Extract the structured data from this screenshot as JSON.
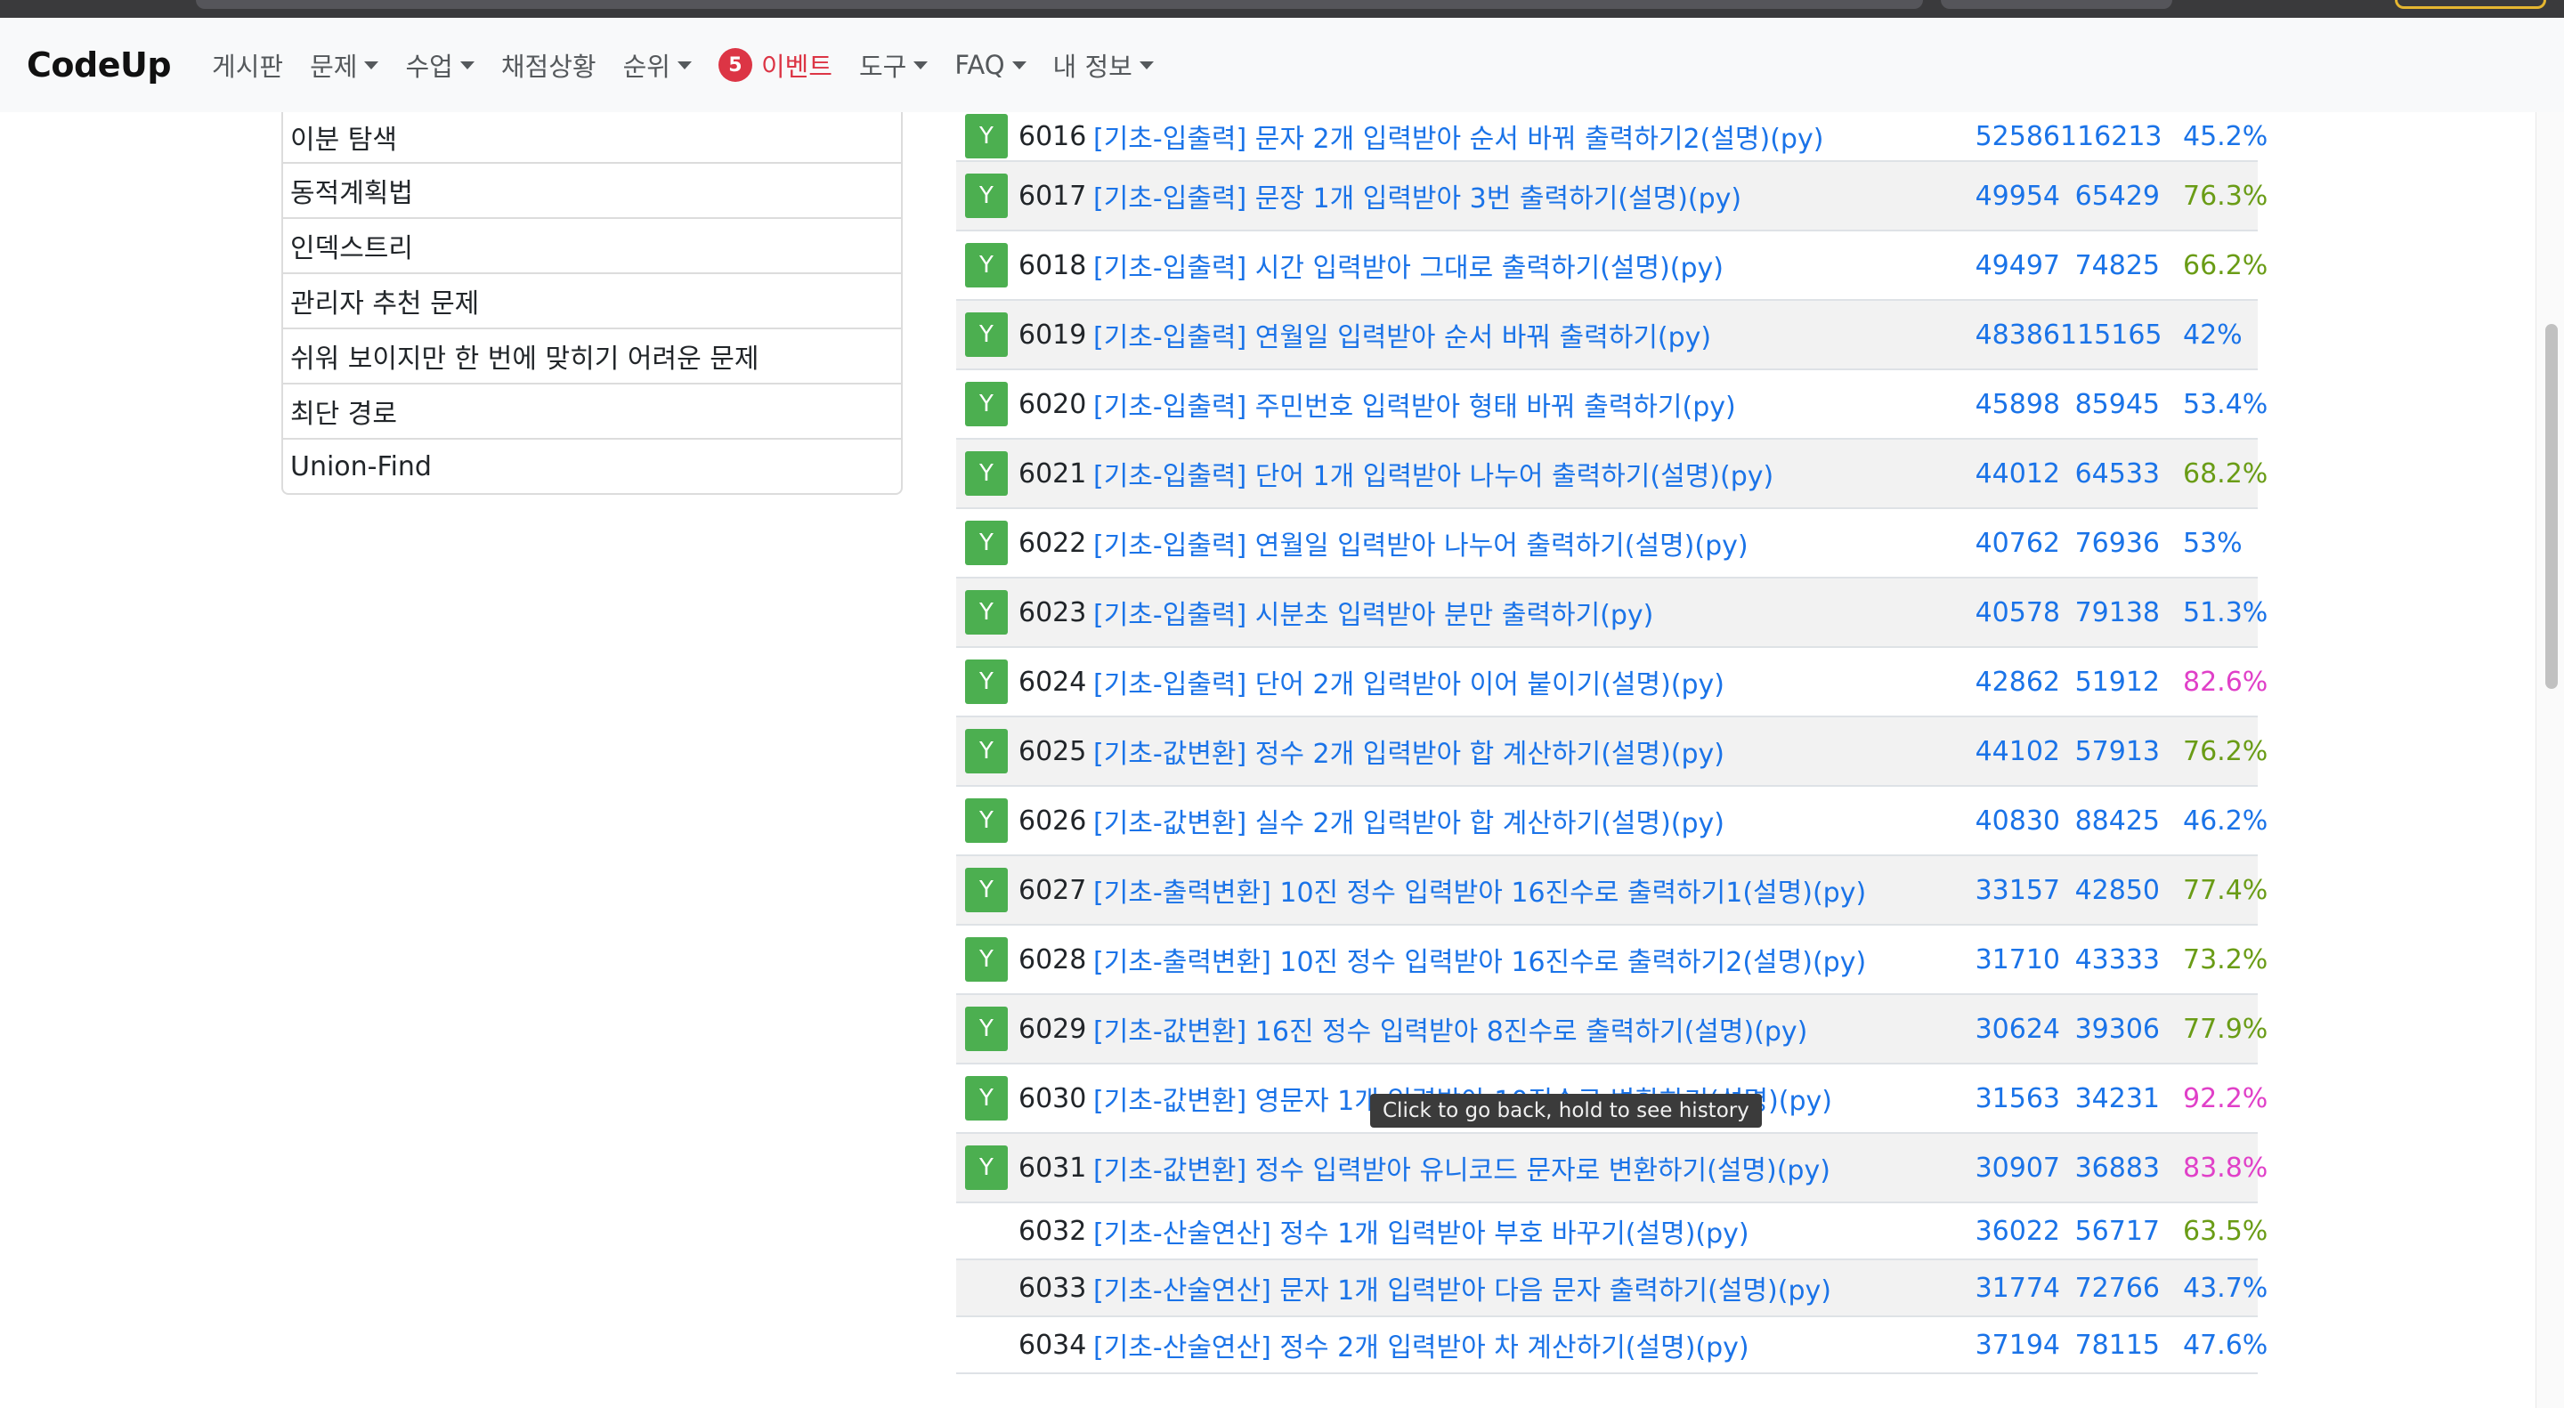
{
  "nav": {
    "brand": "CodeUp",
    "items": [
      {
        "label": "게시판",
        "caret": false
      },
      {
        "label": "문제",
        "caret": true
      },
      {
        "label": "수업",
        "caret": true
      },
      {
        "label": "채점상황",
        "caret": false
      },
      {
        "label": "순위",
        "caret": true
      }
    ],
    "event": {
      "badge": "5",
      "label": "이벤트"
    },
    "items2": [
      {
        "label": "도구",
        "caret": true
      },
      {
        "label": "FAQ",
        "caret": true
      },
      {
        "label": "내 정보",
        "caret": true
      }
    ]
  },
  "sidebar": {
    "items": [
      "이분 탐색",
      "동적계획법",
      "인덱스트리",
      "관리자 추천 문제",
      "쉬워 보이지만 한 번에 맞히기 어려운 문제",
      "최단 경로",
      "Union-Find"
    ]
  },
  "problems": [
    {
      "solved": "Y",
      "id": "6016",
      "title": "[기초-입출력] 문자 2개 입력받아 순서 바꿔 출력하기2(설명)(py)",
      "correct": "52586",
      "submit": "116213",
      "rate": "45.2%",
      "rate_color": "#1a73e8"
    },
    {
      "solved": "Y",
      "id": "6017",
      "title": "[기초-입출력] 문장 1개 입력받아 3번 출력하기(설명)(py)",
      "correct": "49954",
      "submit": "65429",
      "rate": "76.3%",
      "rate_color": "#6a9c16"
    },
    {
      "solved": "Y",
      "id": "6018",
      "title": "[기초-입출력] 시간 입력받아 그대로 출력하기(설명)(py)",
      "correct": "49497",
      "submit": "74825",
      "rate": "66.2%",
      "rate_color": "#6a9c16"
    },
    {
      "solved": "Y",
      "id": "6019",
      "title": "[기초-입출력] 연월일 입력받아 순서 바꿔 출력하기(py)",
      "correct": "48386",
      "submit": "115165",
      "rate": "42%",
      "rate_color": "#1a73e8"
    },
    {
      "solved": "Y",
      "id": "6020",
      "title": "[기초-입출력] 주민번호 입력받아 형태 바꿔 출력하기(py)",
      "correct": "45898",
      "submit": "85945",
      "rate": "53.4%",
      "rate_color": "#1a73e8"
    },
    {
      "solved": "Y",
      "id": "6021",
      "title": "[기초-입출력] 단어 1개 입력받아 나누어 출력하기(설명)(py)",
      "correct": "44012",
      "submit": "64533",
      "rate": "68.2%",
      "rate_color": "#6a9c16"
    },
    {
      "solved": "Y",
      "id": "6022",
      "title": "[기초-입출력] 연월일 입력받아 나누어 출력하기(설명)(py)",
      "correct": "40762",
      "submit": "76936",
      "rate": "53%",
      "rate_color": "#1a73e8"
    },
    {
      "solved": "Y",
      "id": "6023",
      "title": "[기초-입출력] 시분초 입력받아 분만 출력하기(py)",
      "correct": "40578",
      "submit": "79138",
      "rate": "51.3%",
      "rate_color": "#1a73e8"
    },
    {
      "solved": "Y",
      "id": "6024",
      "title": "[기초-입출력] 단어 2개 입력받아 이어 붙이기(설명)(py)",
      "correct": "42862",
      "submit": "51912",
      "rate": "82.6%",
      "rate_color": "#e040c8"
    },
    {
      "solved": "Y",
      "id": "6025",
      "title": "[기초-값변환] 정수 2개 입력받아 합 계산하기(설명)(py)",
      "correct": "44102",
      "submit": "57913",
      "rate": "76.2%",
      "rate_color": "#6a9c16"
    },
    {
      "solved": "Y",
      "id": "6026",
      "title": "[기초-값변환] 실수 2개 입력받아 합 계산하기(설명)(py)",
      "correct": "40830",
      "submit": "88425",
      "rate": "46.2%",
      "rate_color": "#1a73e8"
    },
    {
      "solved": "Y",
      "id": "6027",
      "title": "[기초-출력변환] 10진 정수 입력받아 16진수로 출력하기1(설명)(py)",
      "correct": "33157",
      "submit": "42850",
      "rate": "77.4%",
      "rate_color": "#6a9c16"
    },
    {
      "solved": "Y",
      "id": "6028",
      "title": "[기초-출력변환] 10진 정수 입력받아 16진수로 출력하기2(설명)(py)",
      "correct": "31710",
      "submit": "43333",
      "rate": "73.2%",
      "rate_color": "#6a9c16"
    },
    {
      "solved": "Y",
      "id": "6029",
      "title": "[기초-값변환] 16진 정수 입력받아 8진수로 출력하기(설명)(py)",
      "correct": "30624",
      "submit": "39306",
      "rate": "77.9%",
      "rate_color": "#6a9c16"
    },
    {
      "solved": "Y",
      "id": "6030",
      "title": "[기초-값변환] 영문자 1개 입력받아 10진수로 변환하기(설명)(py)",
      "correct": "31563",
      "submit": "34231",
      "rate": "92.2%",
      "rate_color": "#e040c8"
    },
    {
      "solved": "Y",
      "id": "6031",
      "title": "[기초-값변환] 정수 입력받아 유니코드 문자로 변환하기(설명)(py)",
      "correct": "30907",
      "submit": "36883",
      "rate": "83.8%",
      "rate_color": "#e040c8"
    },
    {
      "solved": "",
      "id": "6032",
      "title": "[기초-산술연산] 정수 1개 입력받아 부호 바꾸기(설명)(py)",
      "correct": "36022",
      "submit": "56717",
      "rate": "63.5%",
      "rate_color": "#6a9c16"
    },
    {
      "solved": "",
      "id": "6033",
      "title": "[기초-산술연산] 문자 1개 입력받아 다음 문자 출력하기(설명)(py)",
      "correct": "31774",
      "submit": "72766",
      "rate": "43.7%",
      "rate_color": "#1a73e8"
    },
    {
      "solved": "",
      "id": "6034",
      "title": "[기초-산술연산] 정수 2개 입력받아 차 계산하기(설명)(py)",
      "correct": "37194",
      "submit": "78115",
      "rate": "47.6%",
      "rate_color": "#1a73e8"
    }
  ],
  "tooltip": "Click to go back, hold to see history"
}
